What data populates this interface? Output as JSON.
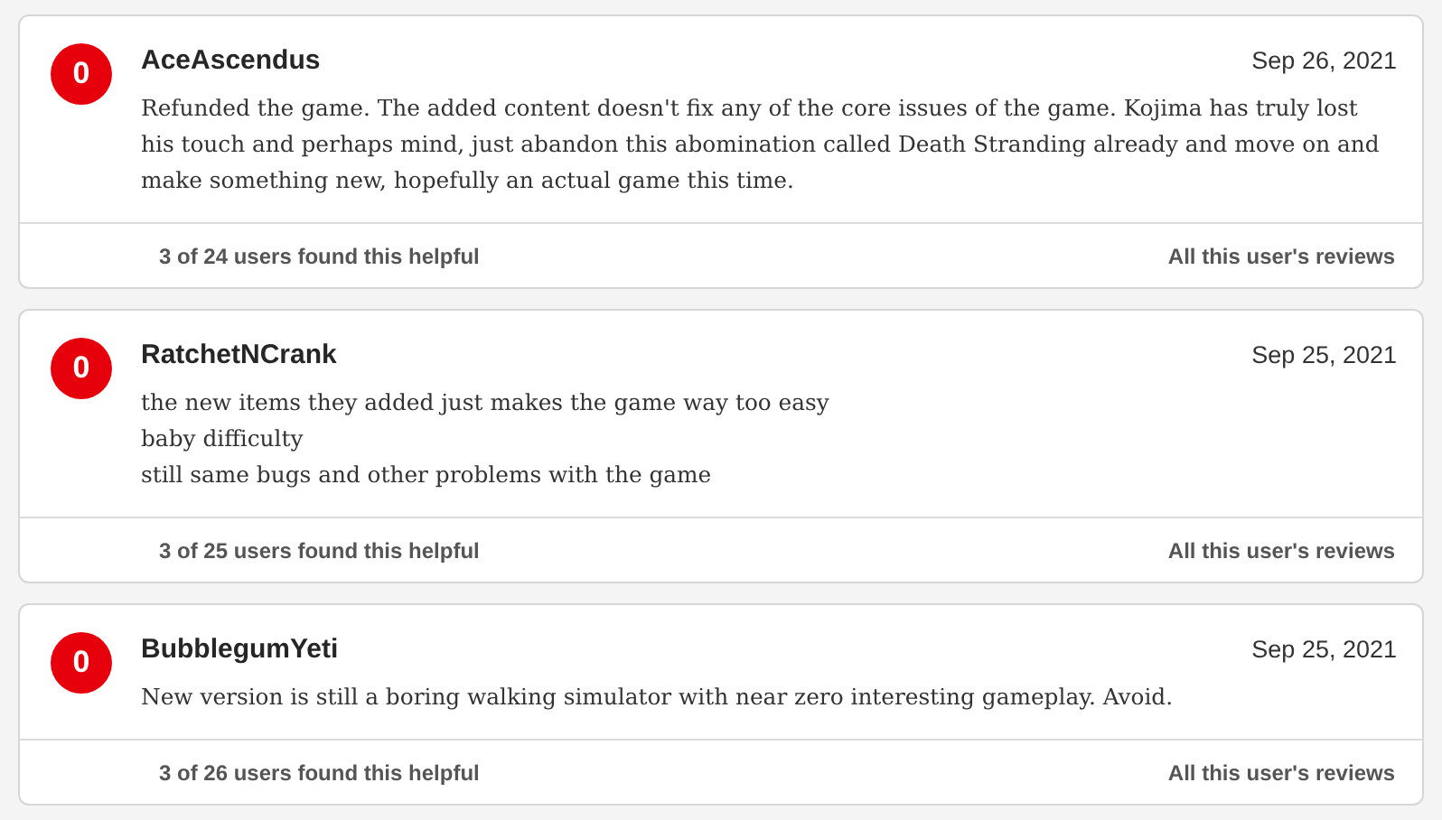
{
  "reviews": [
    {
      "score": "0",
      "user": "AceAscendus",
      "date": "Sep 26, 2021",
      "lines": [
        "Refunded the game. The added content doesn't fix any of the core issues of the game. Kojima has truly lost his touch and perhaps mind, just abandon this abomination called Death Stranding already and move on and make something new, hopefully an actual game this time."
      ],
      "helpful": "3 of 24 users found this helpful",
      "all_reviews": "All this user's reviews"
    },
    {
      "score": "0",
      "user": "RatchetNCrank",
      "date": "Sep 25, 2021",
      "lines": [
        "the new items they added just makes the game way too easy",
        "baby difficulty",
        "still same bugs and other problems with the game"
      ],
      "helpful": "3 of 25 users found this helpful",
      "all_reviews": "All this user's reviews"
    },
    {
      "score": "0",
      "user": "BubblegumYeti",
      "date": "Sep 25, 2021",
      "lines": [
        "New version is still a boring walking simulator with near zero interesting gameplay. Avoid."
      ],
      "helpful": "3 of 26 users found this helpful",
      "all_reviews": "All this user's reviews"
    }
  ]
}
